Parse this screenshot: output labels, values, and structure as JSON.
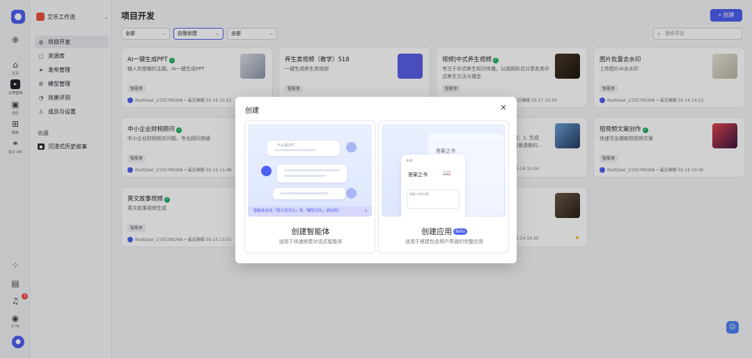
{
  "rail": {
    "items": [
      {
        "label": "",
        "icon": "plus-icon"
      },
      {
        "label": "主页",
        "icon": "home-icon"
      },
      {
        "label": "工作空间",
        "icon": "workspace-icon",
        "active": true
      },
      {
        "label": "商店",
        "icon": "store-icon"
      },
      {
        "label": "模板",
        "icon": "template-icon"
      },
      {
        "label": "扣子 API",
        "icon": "api-icon"
      }
    ],
    "bottom": {
      "notification_count": "3",
      "credits": "9.7K"
    }
  },
  "sidebar": {
    "workspace_name": "艾乐工作流",
    "items": [
      {
        "label": "项目开发",
        "active": true
      },
      {
        "label": "资源库"
      },
      {
        "label": "发布管理"
      },
      {
        "label": "模型管理"
      },
      {
        "label": "效果评测"
      },
      {
        "label": "成员与设置"
      }
    ],
    "favorites_heading": "收藏",
    "favorites": [
      {
        "label": "沉浸式历史故事"
      }
    ]
  },
  "main": {
    "title": "项目开发",
    "create_label": "+ 创建",
    "filters": [
      "全部",
      "由我创建",
      "全部"
    ],
    "search_placeholder": "搜索项目"
  },
  "cards": [
    {
      "title": "AI一键生成PPT",
      "verified": true,
      "desc": "输入你想做的主题，AI一键生成PPT",
      "tag": "智能体",
      "meta": "RootUser_2105780268 • 最近编辑 05-16 15:12"
    },
    {
      "title": "养生类视频（教学）518",
      "verified": false,
      "desc": "一键生成养生类视频",
      "tag": "智能体",
      "meta": ""
    },
    {
      "title": "视频|中式养生视频",
      "verified": true,
      "desc": "专注于中式养生知识传播，以视频形式分享各类中式养生方法与理念",
      "tag": "智能体",
      "meta": "最近编辑 05-17 10:20"
    },
    {
      "title": "图片批量去水印",
      "verified": false,
      "desc": "上传图片AI去水印",
      "tag": "智能体",
      "meta": "RootUser_2105780268 • 最近编辑 05-16 14:23"
    },
    {
      "title": "中小企业财税顾问",
      "verified": true,
      "desc": "中小企业财税相关问题，专业顾问答疑",
      "tag": "智能体",
      "meta": "RootUser_2105780268 • 最近编辑 05-16 11:48"
    },
    {
      "title": "",
      "verified": false,
      "desc": "描：1. 生成\n情景清晰的…",
      "tag": "",
      "meta": "05-16 11:04"
    },
    {
      "title": "短视频文案创作",
      "verified": true,
      "desc": "快速写出爆款短视频文案",
      "tag": "智能体",
      "meta": "RootUser_2105780268 • 最近编辑 05-16 10:36"
    },
    {
      "title": "英文故事视频",
      "verified": true,
      "desc": "英文故事视频生成",
      "tag": "智能体",
      "meta": "RootUser_2105780268 • 最近编辑 05-15 13:55"
    },
    {
      "title": "",
      "verified": false,
      "desc": "",
      "tag": "",
      "meta": "05-14 14:30"
    }
  ],
  "modal": {
    "title": "创建",
    "close": "×",
    "agent": {
      "title": "创建智能体",
      "subtitle": "适用于快速搭建对话式智能体",
      "prompt": "什么是GPT",
      "tip": "智能体支持「提示词对比」和「模型对比」调试啦！",
      "tip_close": "×"
    },
    "app": {
      "title": "创建应用",
      "badge": "Beta",
      "subtitle": "适用于搭建包含用户界面的完整应用",
      "preview_title": "答案之书",
      "phone_time": "9:41",
      "phone_hint": "请输入你的问题"
    }
  },
  "colors": {
    "accent": "#4e5ff0",
    "verified": "#1aaf5d",
    "danger": "#f53f3f"
  }
}
